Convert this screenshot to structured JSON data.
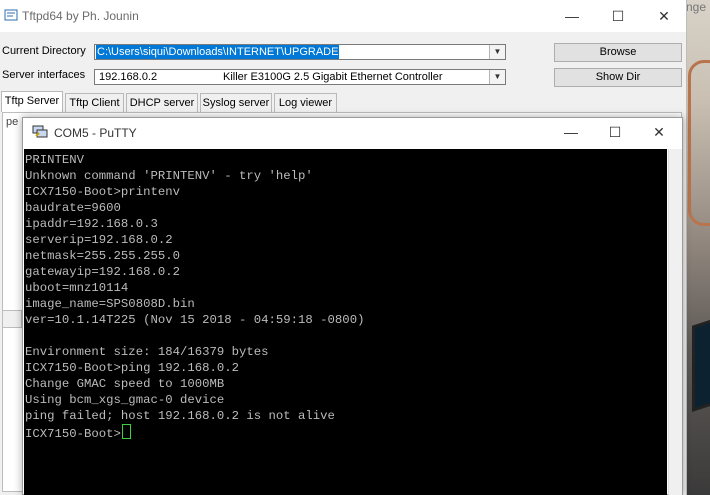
{
  "background": {
    "text_fragment": "nge"
  },
  "tftpd": {
    "title": "Tftpd64 by Ph. Jounin",
    "minimize": "—",
    "maximize": "☐",
    "close": "✕",
    "current_directory_label": "Current Directory",
    "current_directory_value": "C:\\Users\\siqui\\Downloads\\INTERNET\\UPGRADE",
    "server_interfaces_label": "Server interfaces",
    "server_interface_ip": "192.168.0.2",
    "server_interface_adapter": "Killer E3100G 2.5 Gigabit Ethernet Controller",
    "browse_label": "Browse",
    "show_dir_label": "Show Dir",
    "tabs": [
      "Tftp Server",
      "Tftp Client",
      "DHCP server",
      "Syslog server",
      "Log viewer"
    ],
    "panel_fragment": "pe"
  },
  "putty": {
    "title": "COM5 - PuTTY",
    "minimize": "—",
    "maximize": "☐",
    "close": "✕",
    "terminal_lines": [
      "PRINTENV",
      "Unknown command 'PRINTENV' - try 'help'",
      "ICX7150-Boot>printenv",
      "baudrate=9600",
      "ipaddr=192.168.0.3",
      "serverip=192.168.0.2",
      "netmask=255.255.255.0",
      "gatewayip=192.168.0.2",
      "uboot=mnz10114",
      "image_name=SPS0808D.bin",
      "ver=10.1.14T225 (Nov 15 2018 - 04:59:18 -0800)",
      "",
      "Environment size: 184/16379 bytes",
      "ICX7150-Boot>ping 192.168.0.2",
      "Change GMAC speed to 1000MB",
      "Using bcm_xgs_gmac-0 device",
      "ping failed; host 192.168.0.2 is not alive"
    ],
    "prompt": "ICX7150-Boot>"
  },
  "colors": {
    "terminal_bg": "#000000",
    "terminal_text": "#bbbbbb",
    "cursor": "#3cd23c",
    "selection": "#0078d7"
  }
}
